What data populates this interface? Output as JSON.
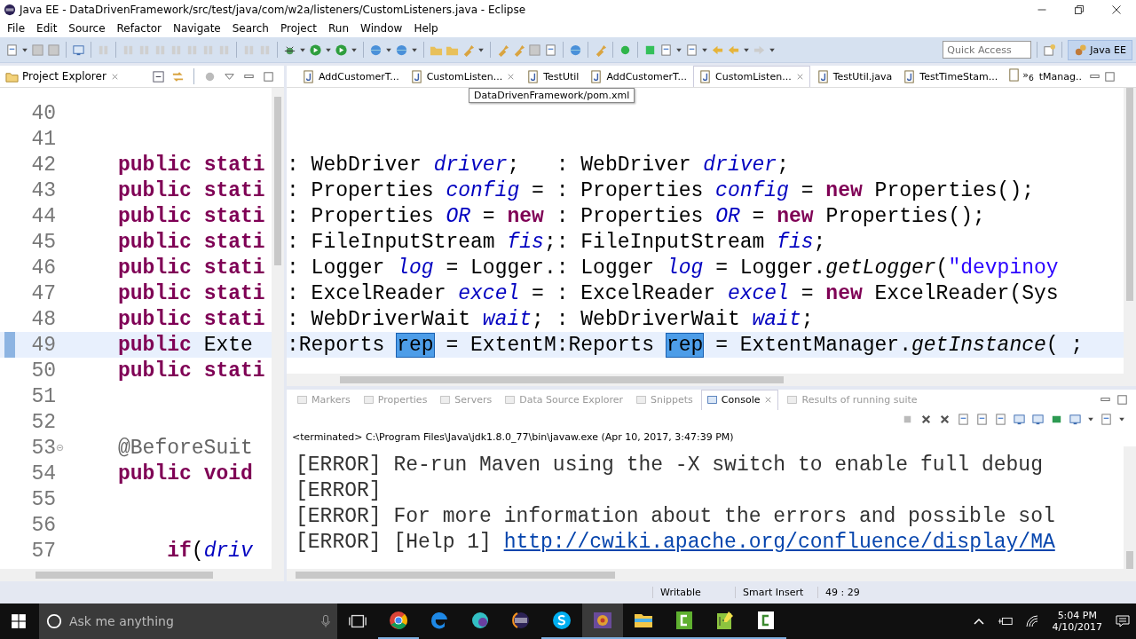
{
  "window": {
    "title": "Java EE - DataDrivenFramework/src/test/java/com/w2a/listeners/CustomListeners.java - Eclipse"
  },
  "menu": [
    "File",
    "Edit",
    "Source",
    "Refactor",
    "Navigate",
    "Search",
    "Project",
    "Run",
    "Window",
    "Help"
  ],
  "quick_access": {
    "placeholder": "Quick Access"
  },
  "perspective": {
    "label": "Java EE",
    "selected": true
  },
  "project_explorer": {
    "title": "Project Explorer"
  },
  "left_editor": {
    "lines": [
      {
        "number": "40",
        "current": false,
        "collapsible": false
      },
      {
        "number": "41",
        "current": false,
        "collapsible": false
      },
      {
        "number": "42",
        "current": false,
        "collapsible": false,
        "tokens": [
          {
            "text": "public",
            "kind": "kw"
          },
          {
            "text": " stati",
            "kind": "kw"
          }
        ]
      },
      {
        "number": "43",
        "current": false,
        "collapsible": false,
        "tokens": [
          {
            "text": "public",
            "kind": "kw"
          },
          {
            "text": " stati",
            "kind": "kw"
          }
        ]
      },
      {
        "number": "44",
        "current": false,
        "collapsible": false,
        "tokens": [
          {
            "text": "public",
            "kind": "kw"
          },
          {
            "text": " stati",
            "kind": "kw"
          }
        ]
      },
      {
        "number": "45",
        "current": false,
        "collapsible": false,
        "tokens": [
          {
            "text": "public",
            "kind": "kw"
          },
          {
            "text": " stati",
            "kind": "kw"
          }
        ]
      },
      {
        "number": "46",
        "current": false,
        "collapsible": false,
        "tokens": [
          {
            "text": "public",
            "kind": "kw"
          },
          {
            "text": " stati",
            "kind": "kw"
          }
        ]
      },
      {
        "number": "47",
        "current": false,
        "collapsible": false,
        "tokens": [
          {
            "text": "public",
            "kind": "kw"
          },
          {
            "text": " stati",
            "kind": "kw"
          }
        ]
      },
      {
        "number": "48",
        "current": false,
        "collapsible": false,
        "tokens": [
          {
            "text": "public",
            "kind": "kw"
          },
          {
            "text": " stati",
            "kind": "kw"
          }
        ]
      },
      {
        "number": "49",
        "current": true,
        "collapsible": false,
        "tokens": [
          {
            "text": "public",
            "kind": "kw"
          },
          {
            "text": " Exte",
            "kind": "plain"
          }
        ]
      },
      {
        "number": "50",
        "current": false,
        "collapsible": false,
        "tokens": [
          {
            "text": "public",
            "kind": "kw"
          },
          {
            "text": " stati",
            "kind": "kw"
          }
        ]
      },
      {
        "number": "51",
        "current": false,
        "collapsible": false
      },
      {
        "number": "52",
        "current": false,
        "collapsible": false
      },
      {
        "number": "53",
        "current": false,
        "collapsible": true,
        "tokens": [
          {
            "text": "@BeforeSuit",
            "kind": "annot"
          }
        ]
      },
      {
        "number": "54",
        "current": false,
        "collapsible": false,
        "tokens": [
          {
            "text": "public",
            "kind": "kw"
          },
          {
            "text": " void",
            "kind": "kw"
          }
        ]
      },
      {
        "number": "55",
        "current": false,
        "collapsible": false
      },
      {
        "number": "56",
        "current": false,
        "collapsible": false
      },
      {
        "number": "57",
        "current": false,
        "collapsible": false,
        "tokens": [
          {
            "text": "    if",
            "kind": "kw"
          },
          {
            "text": "(",
            "kind": "plain"
          },
          {
            "text": "driv",
            "kind": "field"
          }
        ]
      }
    ]
  },
  "editor_tabs": [
    {
      "label": "AddCustomerT...",
      "selected": false,
      "closable": false
    },
    {
      "label": "CustomListen...",
      "selected": false,
      "closable": true
    },
    {
      "label": "TestUtil",
      "selected": false,
      "closable": false
    },
    {
      "label": "AddCustomerT...",
      "selected": false,
      "closable": false
    },
    {
      "label": "CustomListen...",
      "selected": true,
      "closable": true
    },
    {
      "label": "TestUtil.java",
      "selected": false,
      "closable": false
    },
    {
      "label": "TestTimeStam...",
      "selected": false,
      "closable": false
    }
  ],
  "tab_overflow": "»$_{6}$",
  "tab_partial": "tManag..",
  "tooltip": "DataDrivenFramework/pom.xml",
  "right_editor": {
    "lines": [
      [
        {
          "text": ": WebDriver ",
          "kind": "plain"
        },
        {
          "text": "driver",
          "kind": "field"
        },
        {
          "text": ";   : WebDriver ",
          "kind": "plain"
        },
        {
          "text": "driver",
          "kind": "field"
        },
        {
          "text": ";",
          "kind": "plain"
        }
      ],
      [
        {
          "text": ": Properties ",
          "kind": "plain"
        },
        {
          "text": "config",
          "kind": "field"
        },
        {
          "text": " = : Properties ",
          "kind": "plain"
        },
        {
          "text": "config",
          "kind": "field"
        },
        {
          "text": " = ",
          "kind": "plain"
        },
        {
          "text": "new",
          "kind": "kw"
        },
        {
          "text": " Properties();",
          "kind": "plain"
        }
      ],
      [
        {
          "text": ": Properties ",
          "kind": "plain"
        },
        {
          "text": "OR",
          "kind": "field"
        },
        {
          "text": " = ",
          "kind": "plain"
        },
        {
          "text": "new",
          "kind": "kw"
        },
        {
          "text": " : Properties ",
          "kind": "plain"
        },
        {
          "text": "OR",
          "kind": "field"
        },
        {
          "text": " = ",
          "kind": "plain"
        },
        {
          "text": "new",
          "kind": "kw"
        },
        {
          "text": " Properties();",
          "kind": "plain"
        }
      ],
      [
        {
          "text": ": FileInputStream ",
          "kind": "plain"
        },
        {
          "text": "fis",
          "kind": "field"
        },
        {
          "text": ";: FileInputStream ",
          "kind": "plain"
        },
        {
          "text": "fis",
          "kind": "field"
        },
        {
          "text": ";",
          "kind": "plain"
        }
      ],
      [
        {
          "text": ": Logger ",
          "kind": "plain"
        },
        {
          "text": "log",
          "kind": "field"
        },
        {
          "text": " = Logger.: Logger ",
          "kind": "plain"
        },
        {
          "text": "log",
          "kind": "field"
        },
        {
          "text": " = Logger.",
          "kind": "plain"
        },
        {
          "text": "getLogger",
          "kind": "method"
        },
        {
          "text": "(",
          "kind": "plain"
        },
        {
          "text": "\"devpinoy",
          "kind": "string"
        }
      ],
      [
        {
          "text": ": ExcelReader ",
          "kind": "plain"
        },
        {
          "text": "excel",
          "kind": "field"
        },
        {
          "text": " = : ExcelReader ",
          "kind": "plain"
        },
        {
          "text": "excel",
          "kind": "field"
        },
        {
          "text": " = ",
          "kind": "plain"
        },
        {
          "text": "new",
          "kind": "kw"
        },
        {
          "text": " ExcelReader(Sys",
          "kind": "plain"
        }
      ],
      [
        {
          "text": ": WebDriverWait ",
          "kind": "plain"
        },
        {
          "text": "wait",
          "kind": "field"
        },
        {
          "text": "; : WebDriverWait ",
          "kind": "plain"
        },
        {
          "text": "wait",
          "kind": "field"
        },
        {
          "text": ";",
          "kind": "plain"
        }
      ],
      [
        {
          "text": ":Reports ",
          "kind": "plain"
        },
        {
          "text": "rep",
          "kind": "match"
        },
        {
          "text": " = ExtentM:Reports ",
          "kind": "plain"
        },
        {
          "text": "rep",
          "kind": "match"
        },
        {
          "text": " = ExtentManager.",
          "kind": "plain"
        },
        {
          "text": "getInstance",
          "kind": "method"
        },
        {
          "text": "( ;",
          "kind": "plain"
        }
      ]
    ]
  },
  "console_tabs": [
    {
      "label": "Markers",
      "selected": false
    },
    {
      "label": "Properties",
      "selected": false
    },
    {
      "label": "Servers",
      "selected": false
    },
    {
      "label": "Data Source Explorer",
      "selected": false
    },
    {
      "label": "Snippets",
      "selected": false
    },
    {
      "label": "Console",
      "selected": true
    },
    {
      "label": "Results of running suite",
      "selected": false
    }
  ],
  "console": {
    "header": "<terminated> C:\\Program Files\\Java\\jdk1.8.0_77\\bin\\javaw.exe (Apr 10, 2017, 3:47:39 PM)",
    "lines": [
      [
        {
          "text": "[ERROR] Re-run Maven using the -X switch to enable full debug",
          "kind": "plain"
        }
      ],
      [
        {
          "text": "[ERROR]",
          "kind": "plain"
        }
      ],
      [
        {
          "text": "[ERROR] For more information about the errors and possible sol",
          "kind": "plain"
        }
      ],
      [
        {
          "text": "[ERROR] [Help 1] ",
          "kind": "plain"
        },
        {
          "text": "http://cwiki.apache.org/confluence/display/MA",
          "kind": "link"
        }
      ]
    ]
  },
  "status_bar": [
    "Writable",
    "Smart Insert",
    "49 : 29"
  ],
  "taskbar": {
    "search": {
      "placeholder": "Ask me anything"
    },
    "apps": [
      {
        "kind": "chrome",
        "running": true,
        "active": false
      },
      {
        "kind": "edge",
        "running": false,
        "active": false
      },
      {
        "kind": "ring",
        "running": false,
        "active": false
      },
      {
        "kind": "eclipse",
        "running": false,
        "active": false
      },
      {
        "kind": "skype",
        "running": true,
        "active": false
      },
      {
        "kind": "gear",
        "running": true,
        "active": true
      },
      {
        "kind": "folder",
        "running": true,
        "active": false
      },
      {
        "kind": "greensq",
        "running": true,
        "active": false
      },
      {
        "kind": "notepad",
        "running": true,
        "active": false
      },
      {
        "kind": "whitesq",
        "running": true,
        "active": false
      }
    ],
    "time": "5:04 PM",
    "date": "4/10/2017"
  }
}
